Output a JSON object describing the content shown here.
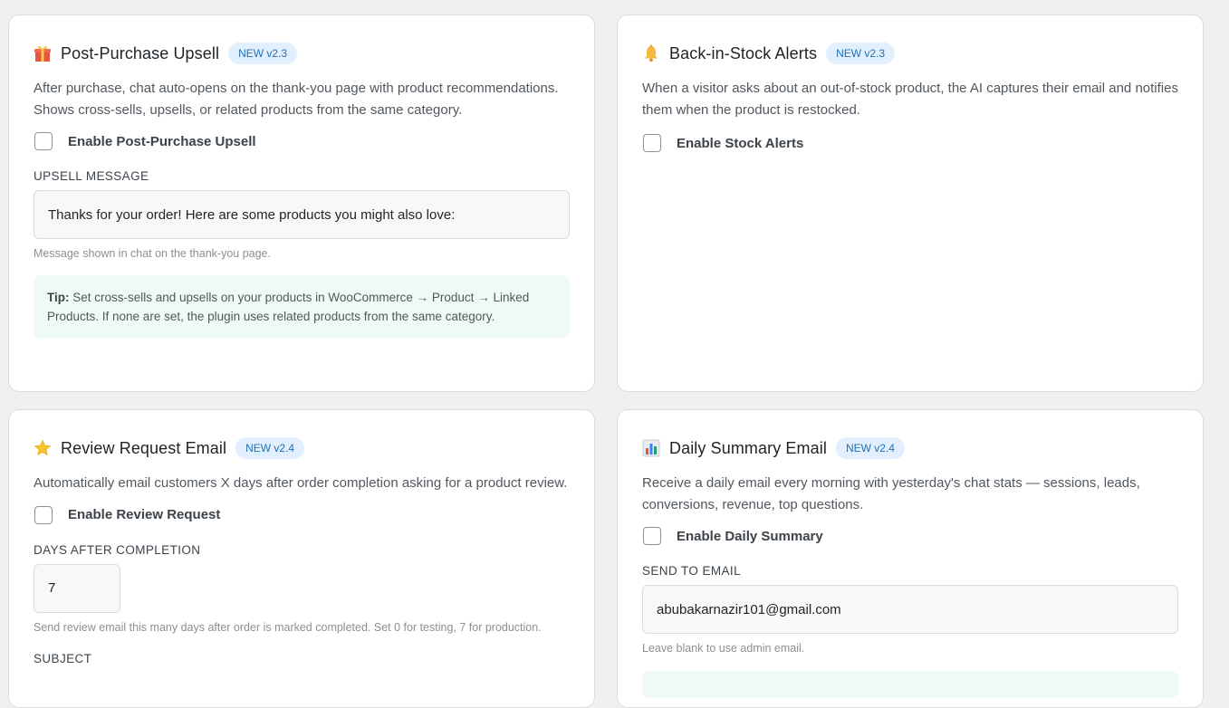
{
  "cards": [
    {
      "icon": "gift-icon",
      "title": "Post-Purchase Upsell",
      "badge": "NEW v2.3",
      "description": "After purchase, chat auto-opens on the thank-you page with product recommendations. Shows cross-sells, upsells, or related products from the same category.",
      "checkbox_label": "Enable Post-Purchase Upsell",
      "checkbox_checked": false,
      "field_label": "UPSELL MESSAGE",
      "field_value": "Thanks for your order! Here are some products you might also love:",
      "help": "Message shown in chat on the thank-you page.",
      "tip_prefix": "Tip:",
      "tip_text": " Set cross-sells and upsells on your products in WooCommerce → Product → Linked Products. If none are set, the plugin uses related products from the same category."
    },
    {
      "icon": "bell-icon",
      "title": "Back-in-Stock Alerts",
      "badge": "NEW v2.3",
      "description": "When a visitor asks about an out-of-stock product, the AI captures their email and notifies them when the product is restocked.",
      "checkbox_label": "Enable Stock Alerts",
      "checkbox_checked": false
    },
    {
      "icon": "star-icon",
      "title": "Review Request Email",
      "badge": "NEW v2.4",
      "description": "Automatically email customers X days after order completion asking for a product review.",
      "checkbox_label": "Enable Review Request",
      "checkbox_checked": false,
      "field_label": "DAYS AFTER COMPLETION",
      "field_value": "7",
      "help": "Send review email this many days after order is marked completed. Set 0 for testing, 7 for production.",
      "next_label": "SUBJECT"
    },
    {
      "icon": "bar-chart-icon",
      "title": "Daily Summary Email",
      "badge": "NEW v2.4",
      "description": "Receive a daily email every morning with yesterday's chat stats — sessions, leads, conversions, revenue, top questions.",
      "checkbox_label": "Enable Daily Summary",
      "checkbox_checked": false,
      "field_label": "SEND TO EMAIL",
      "field_value": "abubakarnazir101@gmail.com",
      "help": "Leave blank to use admin email."
    }
  ],
  "colors": {
    "badge_bg": "#e1efff",
    "badge_text": "#2271b1",
    "tip_bg": "#f0faf4",
    "page_bg": "#f0f0f1"
  }
}
